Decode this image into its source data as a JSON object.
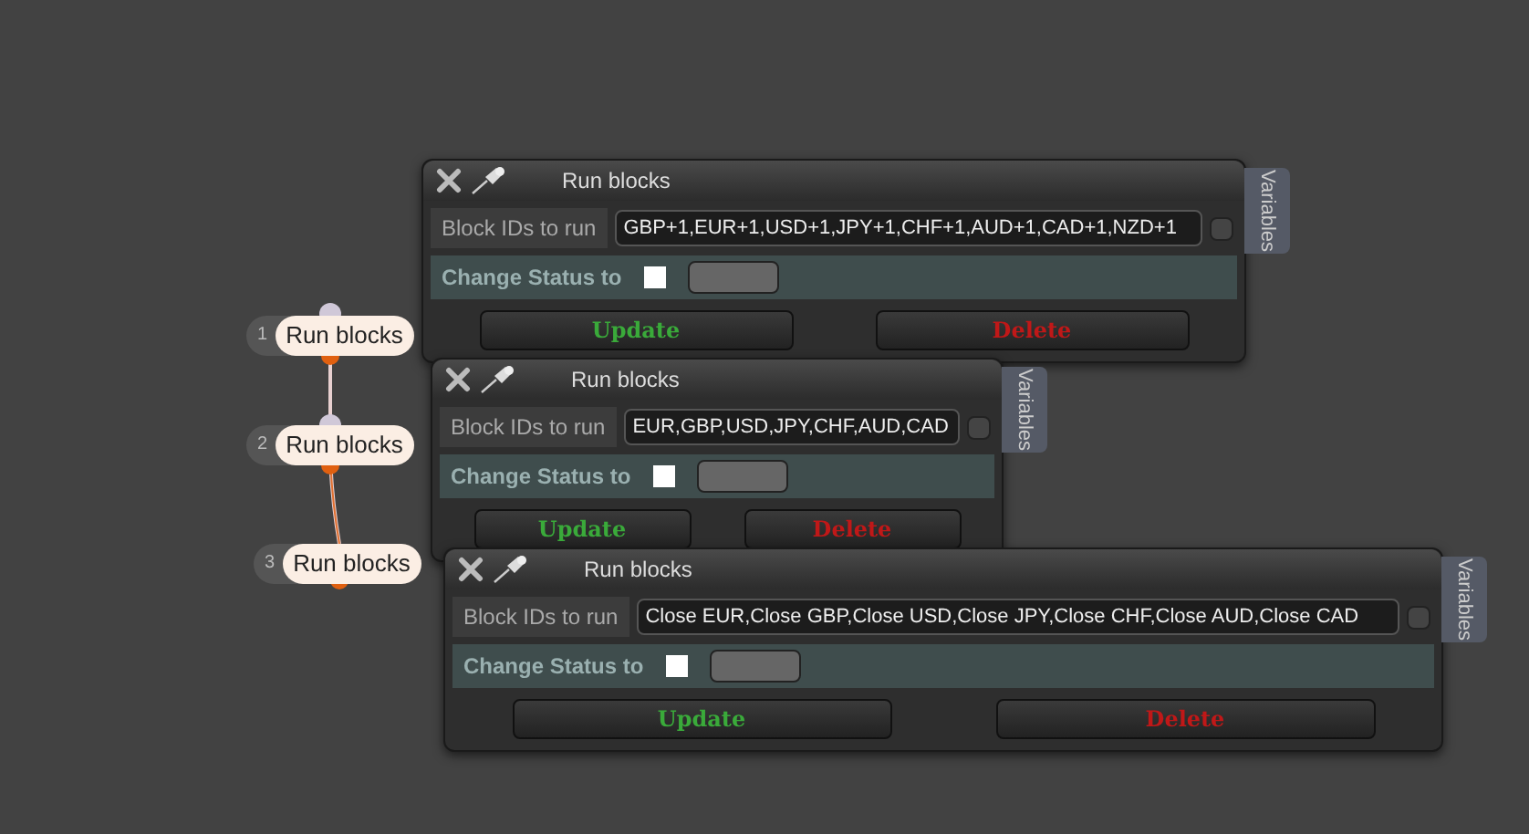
{
  "nodes": [
    {
      "number": "1",
      "label": "Run blocks"
    },
    {
      "number": "2",
      "label": "Run blocks"
    },
    {
      "number": "3",
      "label": "Run blocks"
    }
  ],
  "panels": [
    {
      "title": "Run blocks",
      "side_tab": "Variables",
      "ids_label": "Block IDs to run",
      "ids_value": "GBP+1,EUR+1,USD+1,JPY+1,CHF+1,AUD+1,CAD+1,NZD+1",
      "ids_checked": false,
      "status_label": "Change Status to",
      "status_checked": false,
      "buttons": [
        {
          "label": "Update",
          "kind": "update"
        },
        {
          "label": "Delete",
          "kind": "delete"
        }
      ]
    },
    {
      "title": "Run blocks",
      "side_tab": "Variables",
      "ids_label": "Block IDs to run",
      "ids_value": "EUR,GBP,USD,JPY,CHF,AUD,CAD",
      "ids_checked": false,
      "status_label": "Change Status to",
      "status_checked": false,
      "buttons": [
        {
          "label": "Update",
          "kind": "update"
        },
        {
          "label": "Delete",
          "kind": "delete"
        }
      ]
    },
    {
      "title": "Run blocks",
      "side_tab": "Variables",
      "ids_label": "Block IDs to run",
      "ids_value": "Close EUR,Close GBP,Close USD,Close JPY,Close CHF,Close AUD,Close CAD",
      "ids_checked": false,
      "status_label": "Change Status to",
      "status_checked": false,
      "buttons": [
        {
          "label": "Update",
          "kind": "update"
        },
        {
          "label": "Delete",
          "kind": "delete"
        }
      ]
    }
  ]
}
